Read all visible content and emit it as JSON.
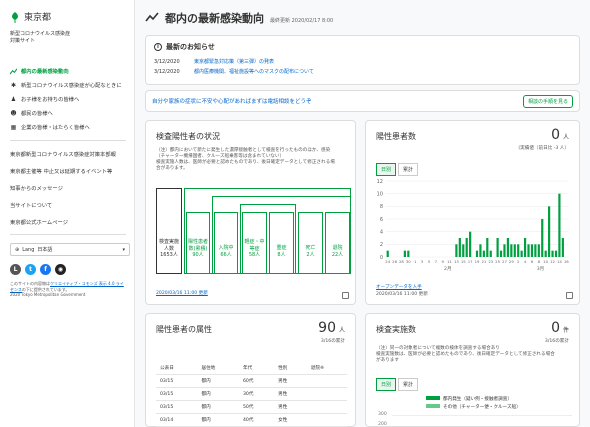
{
  "sidebar": {
    "logo_text": "東京都",
    "site_title_1": "新型コロナウイルス感染症",
    "site_title_2": "対策サイト",
    "nav": [
      {
        "icon": "chart-icon",
        "label": "都内の最新感染動向",
        "active": true
      },
      {
        "icon": "virus-icon",
        "label": "新型コロナウイルス感染症が心配なときに"
      },
      {
        "icon": "family-icon",
        "label": "お子様をお持ちの皆様へ"
      },
      {
        "icon": "people-icon",
        "label": "都民の皆様へ"
      },
      {
        "icon": "building-icon",
        "label": "企業の皆様・はたらく皆様へ"
      }
    ],
    "links": [
      "東京都新型コロナウイルス感染症対策本部報",
      "東京都主催等 中止又は延期するイベント等",
      "知事からのメッセージ",
      "当サイトについて",
      "東京都公式ホームページ"
    ],
    "lang_label": "Lang",
    "lang_value": "日本語",
    "license_1": "このサイトの内容物は",
    "license_link": "クリエイティブ・コモンズ 表示 4.0 ライセンス",
    "license_2": "の下に提供されています。",
    "copyright": "2020 Tokyo Metropolitan Government"
  },
  "header": {
    "title": "都内の最新感染動向",
    "updated": "最終更新 2020/02/17 8:00"
  },
  "news": {
    "title": "最新のお知らせ",
    "items": [
      {
        "date": "3/12/2020",
        "text": "東京都緊急対応策（第三弾）の発表"
      },
      {
        "date": "3/12/2020",
        "text": "都内医療機関、福祉施設等へのマスクの配布について"
      }
    ]
  },
  "consult": {
    "text": "自分や家族の症状に不安や心配があればまずは電話相談をどうぞ",
    "button": "相談の手順を見る"
  },
  "inspection": {
    "title": "検査陽性者の状況",
    "note_1": "（注）都内において新たに発生した濃厚接触者として検査を行ったもののほか、感染",
    "note_2": "（チャーター機帰国者、クルーズ船乗客等は含まれていない）",
    "note_3": "検査実施人数は、医師が必要と認めたものであり、後日確定データとして修正される場",
    "note_4": "合があります。",
    "boxes": [
      {
        "label": "検査実施人数",
        "value": "1653人"
      },
      {
        "label": "陽性患者数(累積)",
        "value": "90人"
      },
      {
        "label": "入院中",
        "value": "66人"
      },
      {
        "label": "軽症・中等症",
        "value": "58人"
      },
      {
        "label": "重症",
        "value": "8人"
      },
      {
        "label": "死亡",
        "value": "2人"
      },
      {
        "label": "退院",
        "value": "22人"
      }
    ],
    "date": "2020/03/16 11:00 更新"
  },
  "positive": {
    "title": "陽性患者数",
    "value": "0",
    "unit": "人",
    "sub": "(実績値（前日比 -3 人）",
    "tabs": [
      "日別",
      "累計"
    ],
    "open_data": "オープンデータを入手",
    "date": "2020/03/16 11:00 更新",
    "month_labels": [
      "2月",
      "3月"
    ]
  },
  "attributes": {
    "title": "陽性患者の属性",
    "value": "90",
    "unit": "人",
    "sub": "3/16の累計",
    "columns": [
      "公表日",
      "居住地",
      "年代",
      "性別",
      "退院※"
    ],
    "rows": [
      [
        "03/15",
        "都内",
        "60代",
        "男性",
        ""
      ],
      [
        "03/15",
        "都内",
        "30代",
        "男性",
        ""
      ],
      [
        "03/15",
        "都内",
        "50代",
        "男性",
        ""
      ],
      [
        "03/14",
        "都内",
        "40代",
        "女性",
        ""
      ]
    ]
  },
  "tests": {
    "title": "検査実施数",
    "value": "0",
    "unit": "件",
    "sub": "3/16の累計",
    "note_1": "（注）同一の対象者について複数の検体を調査する場合あり",
    "note_2": "検査実施数は、医師が必要と認めたものであり、後日確定データとして修正される場合があります",
    "tabs": [
      "日別",
      "累計"
    ],
    "legend": [
      "都内発生（疑い例・接触者調査）",
      "その他（チャーター便・クルーズ船）"
    ],
    "axis_labels": [
      "300",
      "200"
    ]
  },
  "chart_data": {
    "type": "bar",
    "title": "陽性患者数",
    "ylim": [
      0,
      12
    ],
    "yticks": [
      0,
      2,
      4,
      6,
      8,
      10,
      12
    ],
    "x": [
      "1/24",
      "1/25",
      "1/26",
      "1/27",
      "1/28",
      "1/29",
      "1/30",
      "1/31",
      "2/1",
      "2/2",
      "2/3",
      "2/4",
      "2/5",
      "2/6",
      "2/7",
      "2/8",
      "2/9",
      "2/10",
      "2/11",
      "2/12",
      "2/13",
      "2/14",
      "2/15",
      "2/16",
      "2/17",
      "2/18",
      "2/19",
      "2/20",
      "2/21",
      "2/22",
      "2/23",
      "2/24",
      "2/25",
      "2/26",
      "2/27",
      "2/28",
      "2/29",
      "3/1",
      "3/2",
      "3/3",
      "3/4",
      "3/5",
      "3/6",
      "3/7",
      "3/8",
      "3/9",
      "3/10",
      "3/11",
      "3/12",
      "3/13",
      "3/14",
      "3/15",
      "3/16"
    ],
    "values": [
      1,
      0,
      0,
      0,
      0,
      1,
      1,
      0,
      0,
      0,
      0,
      0,
      0,
      0,
      0,
      0,
      0,
      0,
      0,
      0,
      2,
      3,
      2,
      3,
      4,
      0,
      1,
      2,
      1,
      3,
      1,
      0,
      3,
      1,
      2,
      3,
      2,
      2,
      2,
      1,
      3,
      2,
      2,
      2,
      2,
      6,
      1,
      8,
      1,
      1,
      10,
      3,
      0
    ],
    "xticklabels": [
      "24",
      "26",
      "28",
      "30",
      "1",
      "3",
      "5",
      "7",
      "9",
      "11",
      "13",
      "15",
      "17",
      "19",
      "21",
      "23",
      "25",
      "27",
      "29",
      "2",
      "4",
      "6",
      "8",
      "10",
      "12",
      "14",
      "16"
    ],
    "colors": {
      "bar": "#00a040",
      "grid": "#eeeeee"
    }
  }
}
